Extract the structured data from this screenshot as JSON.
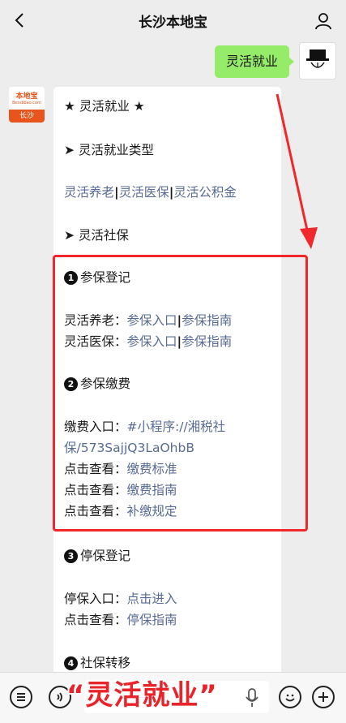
{
  "header": {
    "title": "长沙本地宝"
  },
  "outgoing": {
    "text": "灵活就业"
  },
  "bot": {
    "logo_text": "本地宝",
    "logo_sub": "Bendibao.com",
    "city": "长沙"
  },
  "message": {
    "title": "★ 灵活就业 ★",
    "types_heading": "➤ 灵活就业类型",
    "types": [
      "灵活养老",
      "灵活医保",
      "灵活公积金"
    ],
    "social_heading": "➤ 灵活社保",
    "sections": [
      {
        "num": "1",
        "heading": "参保登记",
        "rows": [
          {
            "label": "灵活养老：",
            "links": [
              "参保入口",
              "参保指南"
            ]
          },
          {
            "label": "灵活医保：",
            "links": [
              "参保入口",
              "参保指南"
            ]
          }
        ]
      },
      {
        "num": "2",
        "heading": "参保缴费",
        "pay_label": "缴费入口：",
        "pay_link_1": "#小程序://湘税社",
        "pay_link_2": "保/573SajjQ3LaOhbB",
        "rows": [
          {
            "label": "点击查看：",
            "link": "缴费标准"
          },
          {
            "label": "点击查看：",
            "link": "缴费指南"
          },
          {
            "label": "点击查看：",
            "link": "补缴规定"
          }
        ]
      },
      {
        "num": "3",
        "heading": "停保登记",
        "rows": [
          {
            "label": "停保入口：",
            "link": "点击进入"
          },
          {
            "label": "点击查看：",
            "link": "停保指南"
          }
        ]
      },
      {
        "num": "4",
        "heading": "社保转移"
      }
    ]
  },
  "caption": "“灵活就业”",
  "colors": {
    "link": "#576b95",
    "outgoing_bubble": "#95ec69",
    "annotation": "#f0272b",
    "caption": "#e8232a"
  },
  "icons": [
    "chevron-left-icon",
    "user-icon",
    "list-icon",
    "voice-icon",
    "mic-icon",
    "emoji-icon",
    "plus-icon"
  ]
}
